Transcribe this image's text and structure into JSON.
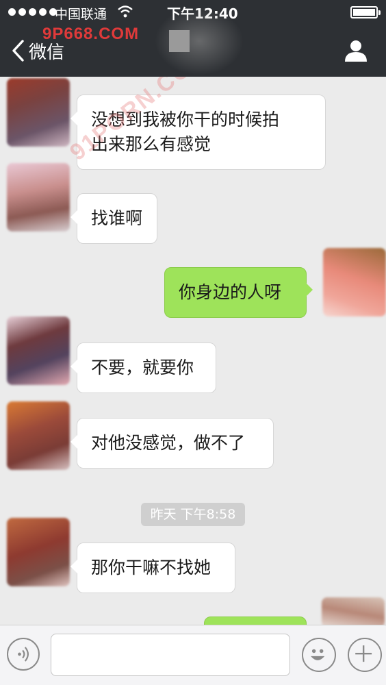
{
  "status_bar": {
    "carrier": "中国联通",
    "clock": "下午12:40"
  },
  "nav": {
    "back_label": "微信",
    "watermark": "9P668.COM"
  },
  "chat": {
    "watermark": "91PORN.COM",
    "timestamp": "昨天 下午8:58",
    "messages": [
      {
        "direction": "in",
        "lines": [
          "没想到我被你干的时候拍",
          "出来那么有感觉"
        ]
      },
      {
        "direction": "in",
        "lines": [
          "找谁啊"
        ]
      },
      {
        "direction": "out",
        "lines": [
          "你身边的人呀"
        ]
      },
      {
        "direction": "in",
        "lines": [
          "不要，就要你"
        ]
      },
      {
        "direction": "in",
        "lines": [
          "对他没感觉，做不了"
        ]
      },
      {
        "direction": "in",
        "lines": [
          "那你干嘛不找她"
        ]
      }
    ]
  },
  "input_bar": {
    "text_value": ""
  },
  "colors": {
    "navbar": "#2d3034",
    "chat_bg": "#ebebeb",
    "outgoing_bubble": "#9ee35a",
    "incoming_bubble": "#ffffff"
  },
  "icons": [
    "wifi-icon",
    "battery-icon",
    "back-chevron-icon",
    "person-icon",
    "voice-icon",
    "emoji-icon",
    "plus-icon"
  ]
}
